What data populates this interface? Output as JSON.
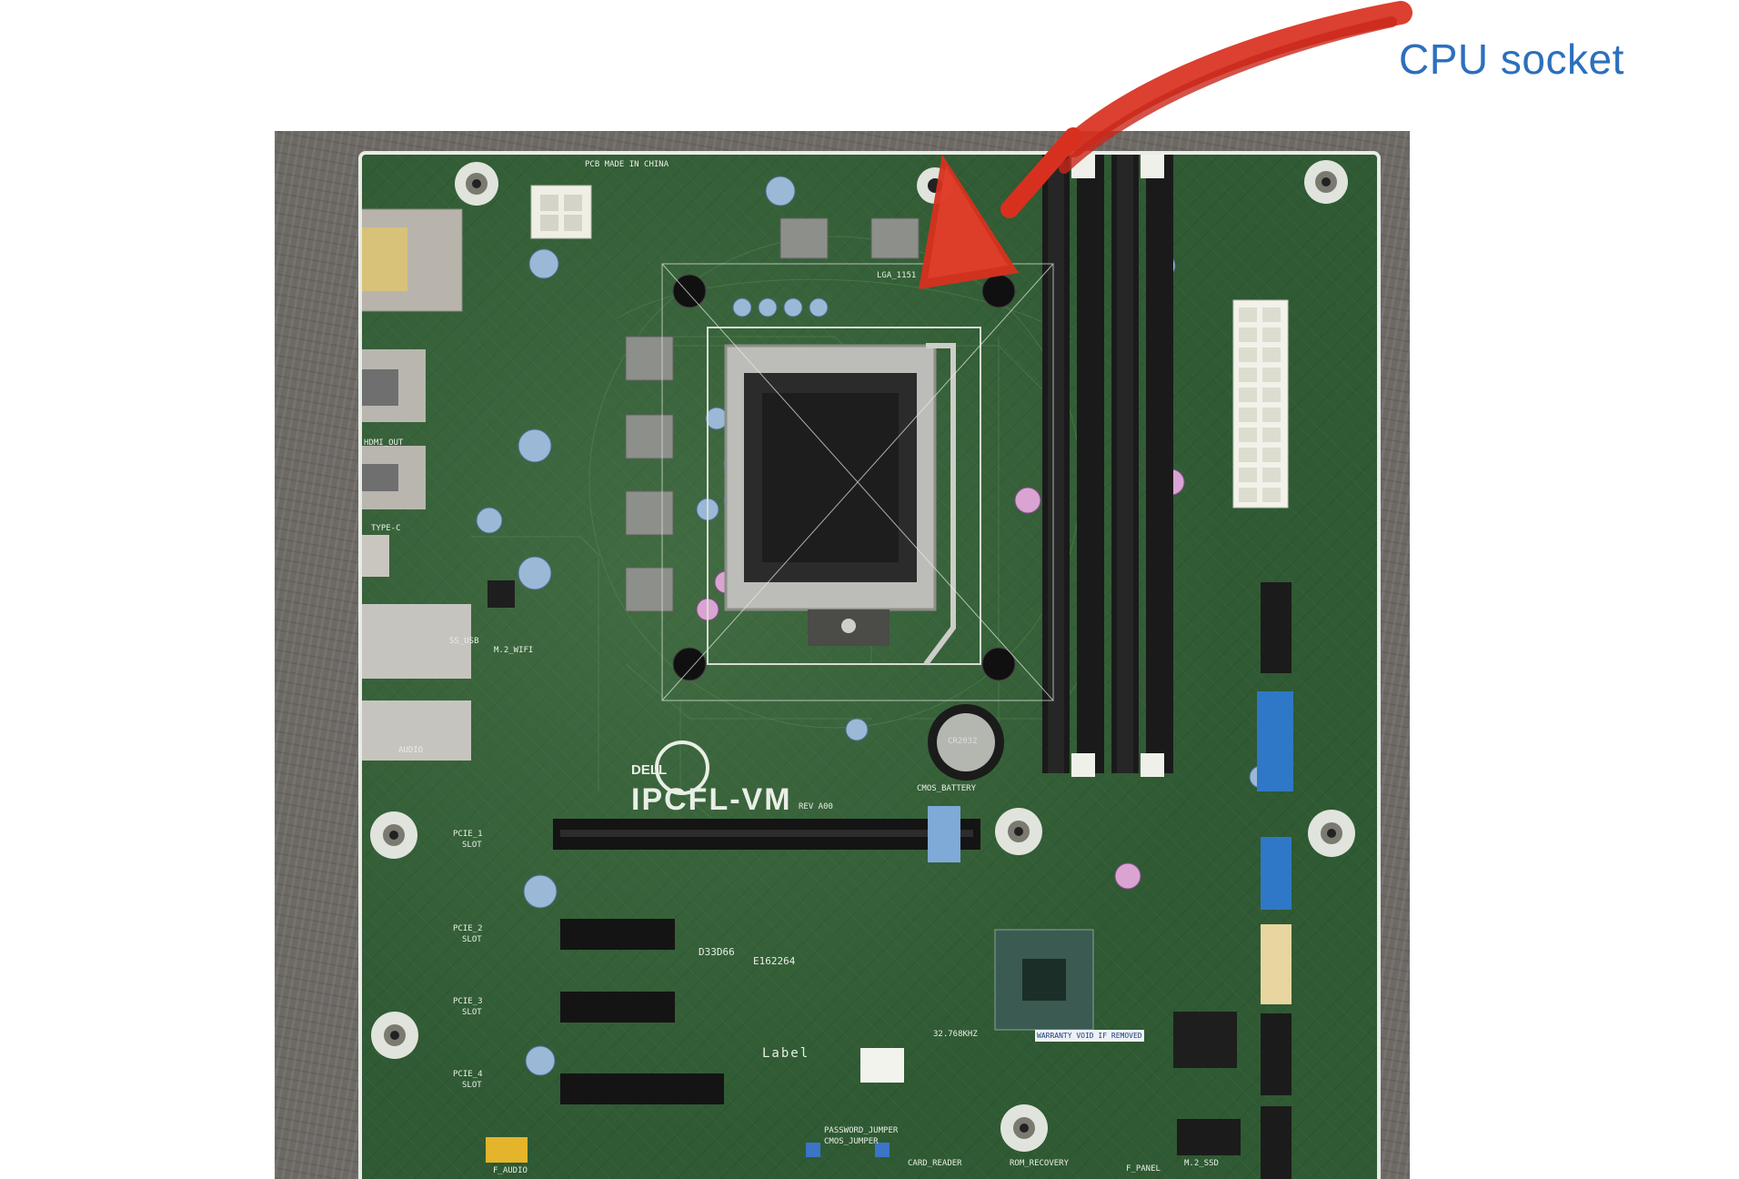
{
  "annotation": {
    "label": "CPU socket",
    "arrow_color": "#d8301e",
    "label_color": "#2c6fbd"
  },
  "board": {
    "model": "IPCFL-VM",
    "brand": "DELL",
    "pcb_note": "PCB MADE IN CHINA",
    "socket_label": "LGA_1151",
    "battery": "CR2032",
    "silkscreen": {
      "hdmi": "HDMI_OUT",
      "type_c": "TYPE-C",
      "ss_usb": "SS_USB",
      "m2_wifi": "M.2_WIFI",
      "audio": "AUDIO",
      "cmos_battery": "CMOS_BATTERY",
      "password_jumper": "PASSWORD_JUMPER",
      "cmos_jumper": "CMOS_JUMPER",
      "card_reader": "CARD_READER",
      "rom_recovery": "ROM_RECOVERY",
      "f_panel": "F_PANEL",
      "f_audio": "F_AUDIO",
      "m2_ssd": "M.2_SSD",
      "label": "Label",
      "cert": "D33D66",
      "e_number": "E162264",
      "pcie1": "PCIE_1",
      "pcie2": "PCIE_2",
      "pcie3": "PCIE_3",
      "pcie4": "PCIE_4",
      "slot": "SLOT",
      "crystal": "32.768KHZ",
      "warranty": "WARRANTY VOID IF REMOVED",
      "rev": "REV A00"
    }
  }
}
